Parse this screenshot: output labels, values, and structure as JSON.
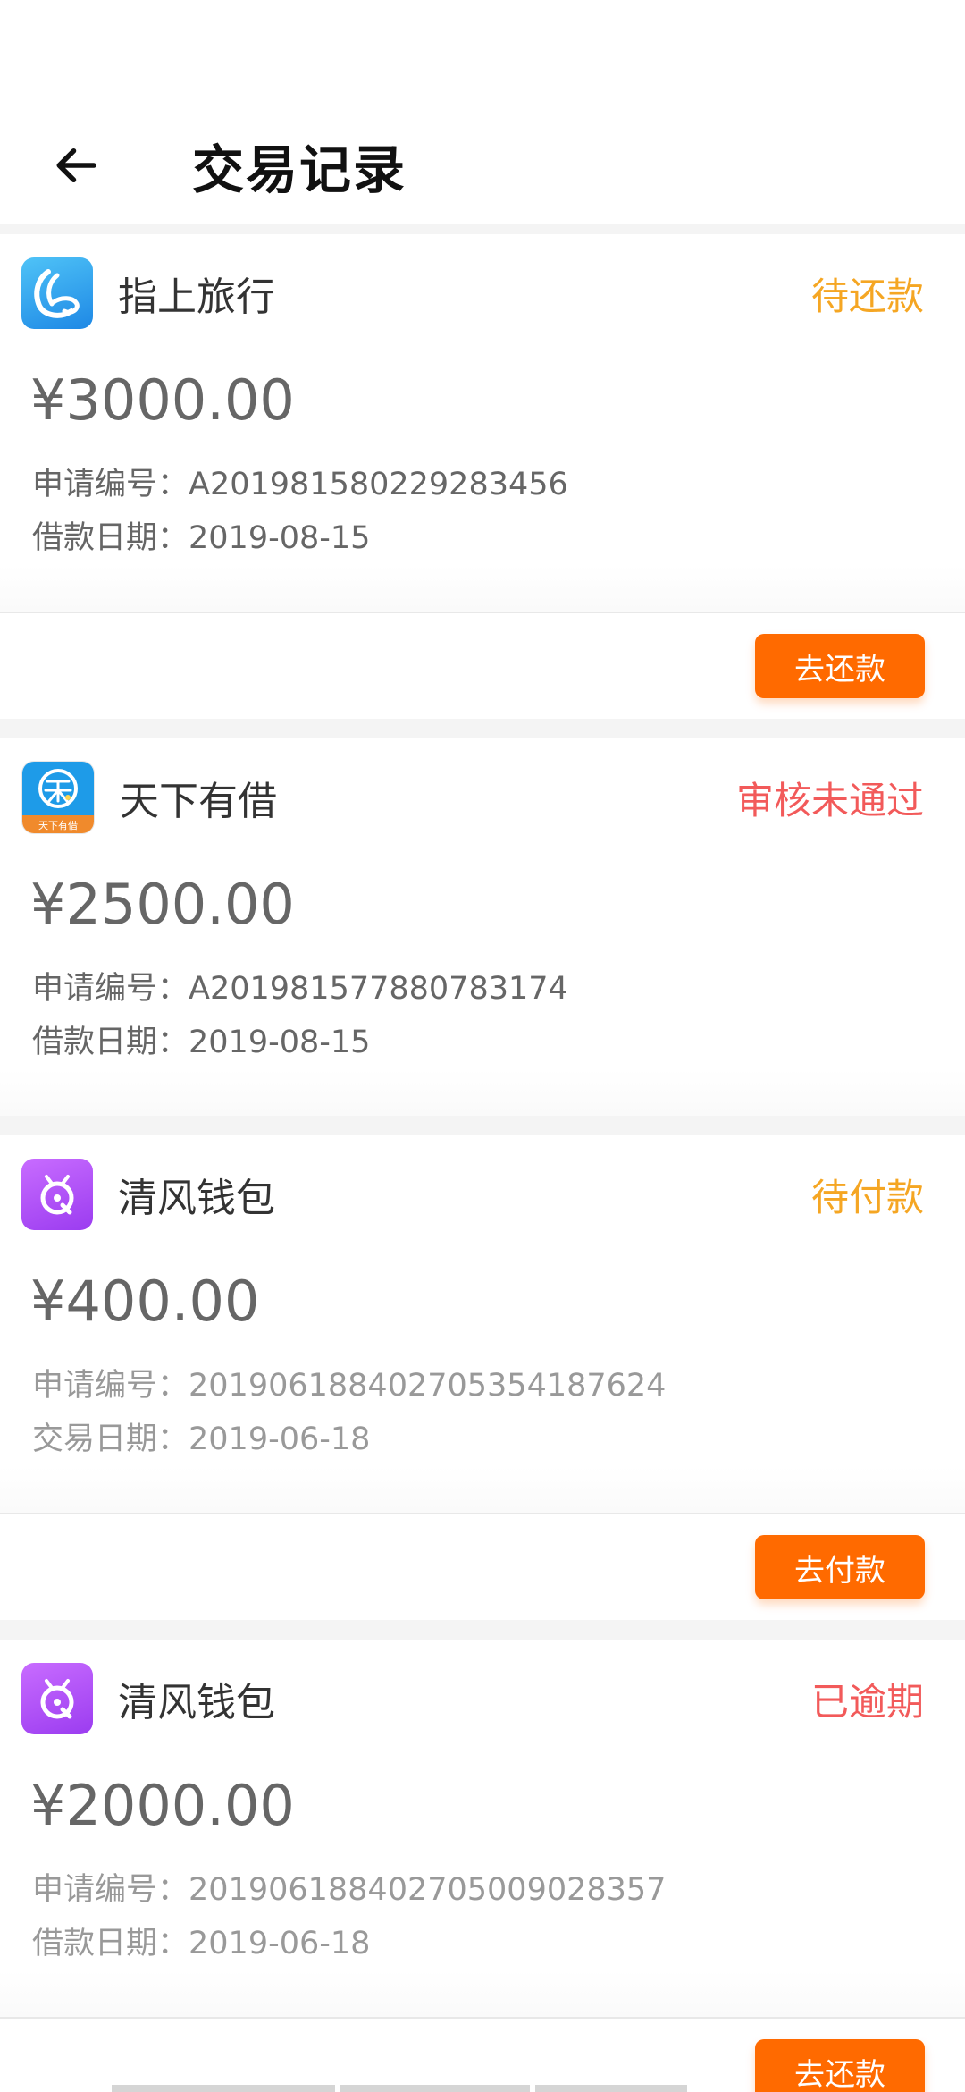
{
  "header": {
    "title": "交易记录"
  },
  "records": [
    {
      "app": "指上旅行",
      "logo": "zhishang-logo-icon",
      "status": "待还款",
      "status_color": "#f5a623",
      "amount": "¥3000.00",
      "fields": [
        {
          "label": "申请编号：",
          "value": "A201981580229283456"
        },
        {
          "label": "借款日期：",
          "value": "2019-08-15"
        }
      ],
      "action": "去还款"
    },
    {
      "app": "天下有借",
      "logo": "tianxia-logo-icon",
      "status": "审核未通过",
      "status_color": "#f25a5a",
      "amount": "¥2500.00",
      "fields": [
        {
          "label": "申请编号：",
          "value": "A201981577880783174"
        },
        {
          "label": "借款日期：",
          "value": "2019-08-15"
        }
      ],
      "logo_text": "天下有借"
    },
    {
      "app": "清风钱包",
      "logo": "qingfeng-logo-icon",
      "status": "待付款",
      "status_color": "#f5a623",
      "amount": "¥400.00",
      "fields": [
        {
          "label": "申请编号：",
          "value": "20190618840270535418762 4"
        },
        {
          "label": "交易日期：",
          "value": "2019-06-18"
        }
      ],
      "action": "去付款"
    },
    {
      "app": "清风钱包",
      "logo": "qingfeng-logo-icon",
      "status": "已逾期",
      "status_color": "#f25a5a",
      "amount": "¥2000.00",
      "fields": [
        {
          "label": "申请编号：",
          "value": "201906188402705009028357"
        },
        {
          "label": "借款日期：",
          "value": "2019-06-18"
        }
      ],
      "action": "去还款"
    }
  ],
  "colors": {
    "action_button": "#ff6a00",
    "pending": "#f5a623",
    "rejected": "#f25a5a"
  }
}
